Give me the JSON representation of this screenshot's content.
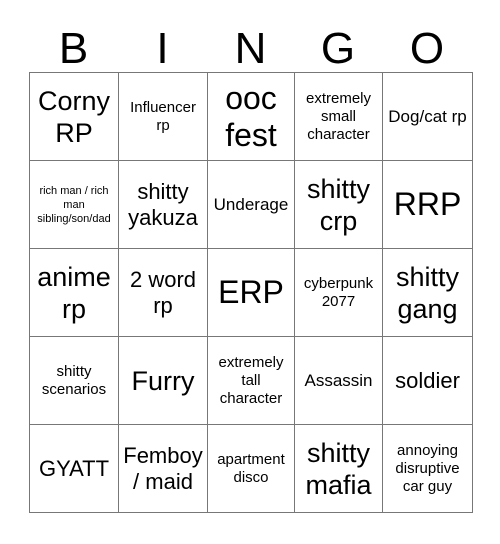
{
  "card": {
    "header_letters": [
      "B",
      "I",
      "N",
      "G",
      "O"
    ],
    "rows": [
      [
        {
          "text": "Corny RP",
          "size": "xl"
        },
        {
          "text": "Influencer rp",
          "size": "s"
        },
        {
          "text": "ooc fest",
          "size": "xxl"
        },
        {
          "text": "extremely small character",
          "size": "s"
        },
        {
          "text": "Dog/cat rp",
          "size": "m"
        }
      ],
      [
        {
          "text": "rich man / rich man sibling/son/dad",
          "size": "xs"
        },
        {
          "text": "shitty yakuza",
          "size": "l"
        },
        {
          "text": "Underage",
          "size": "m"
        },
        {
          "text": "shitty crp",
          "size": "xl"
        },
        {
          "text": "RRP",
          "size": "xxl"
        }
      ],
      [
        {
          "text": "anime rp",
          "size": "xl"
        },
        {
          "text": "2 word rp",
          "size": "l"
        },
        {
          "text": "ERP",
          "size": "xxl"
        },
        {
          "text": "cyberpunk 2077",
          "size": "s"
        },
        {
          "text": "shitty gang",
          "size": "xl"
        }
      ],
      [
        {
          "text": "shitty scenarios",
          "size": "s"
        },
        {
          "text": "Furry",
          "size": "xl"
        },
        {
          "text": "extremely tall character",
          "size": "s"
        },
        {
          "text": "Assassin",
          "size": "m"
        },
        {
          "text": "soldier",
          "size": "l"
        }
      ],
      [
        {
          "text": "GYATT",
          "size": "l"
        },
        {
          "text": "Femboy / maid",
          "size": "l"
        },
        {
          "text": "apartment disco",
          "size": "s"
        },
        {
          "text": "shitty mafia",
          "size": "xl"
        },
        {
          "text": "annoying disruptive car guy",
          "size": "s"
        }
      ]
    ]
  },
  "colors": {
    "background": "#ffffff",
    "text": "#000000",
    "grid_line": "#777777"
  }
}
